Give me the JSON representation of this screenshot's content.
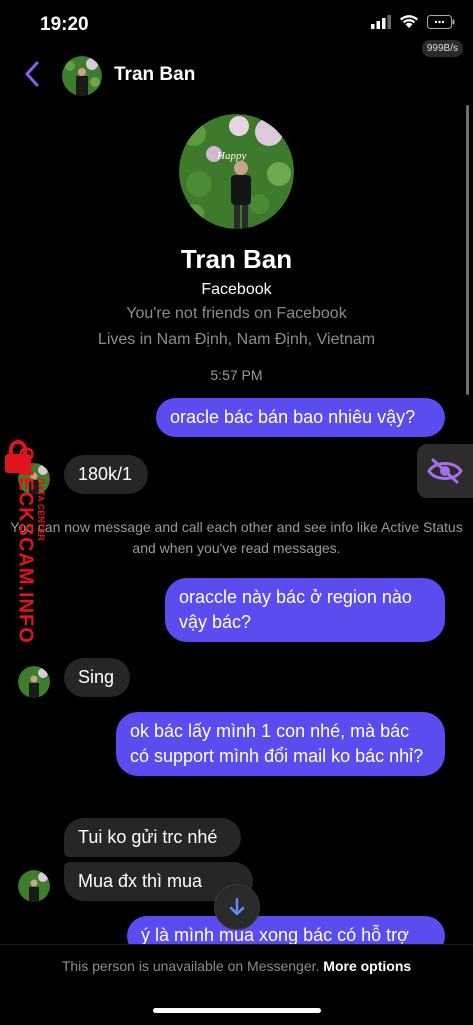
{
  "status_bar": {
    "time": "19:20",
    "net_speed": "999B/s"
  },
  "header": {
    "back_icon": "chevron-left-icon",
    "name": "Tran Ban"
  },
  "profile": {
    "name": "Tran Ban",
    "platform": "Facebook",
    "friend_status": "You're not friends on Facebook",
    "location": "Lives in Nam Định, Nam Định, Vietnam",
    "timestamp": "5:57 PM"
  },
  "messages": [
    {
      "dir": "out",
      "text": "oracle bác bán bao nhiêu vậy?"
    },
    {
      "dir": "in",
      "text": "180k/1"
    },
    {
      "dir": "system",
      "text": "You can now message and call each other and see info like Active Status and when you've read messages."
    },
    {
      "dir": "out",
      "text": "oraccle này bác ở region nào vậy bác?"
    },
    {
      "dir": "in",
      "text": "Sing"
    },
    {
      "dir": "out",
      "text": "ok bác lấy mình 1 con nhé, mà bác có support mình đổi mail ko bác nhỉ?"
    },
    {
      "dir": "in",
      "text": "Tui ko gửi trc nhé"
    },
    {
      "dir": "in",
      "text": "Mua đx thì mua"
    },
    {
      "dir": "out",
      "text": "ý là mình mua xong bác có hỗ trợ"
    }
  ],
  "watermark": {
    "main": "CHECKSCAM.INFO",
    "sub": "DATA CENTER"
  },
  "footer": {
    "notice": "This person is unavailable on Messenger.",
    "more_options": "More options"
  },
  "colors": {
    "accent": "#8a5cf6",
    "bubble_out": "#5b4cf0",
    "bubble_in": "#262626",
    "watermark": "#e0141b"
  }
}
